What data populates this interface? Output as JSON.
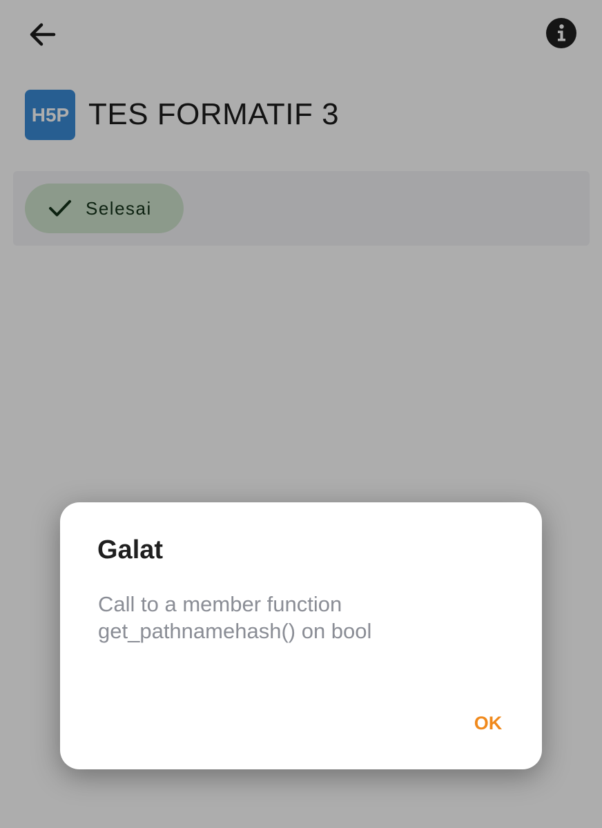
{
  "header": {
    "back_icon": "arrow-left-icon",
    "info_icon": "info-circle-icon",
    "title": "TES FORMATIF 3",
    "logo_text": "H5P",
    "logo_color": "#3a8bd6"
  },
  "completion": {
    "status_label": "Selesai",
    "status_icon": "checkmark-icon",
    "chip_color": "#cfe3cd"
  },
  "dialog": {
    "title": "Galat",
    "message": "Call to a member function get_pathnamehash() on bool",
    "ok_label": "OK",
    "accent_color": "#f0891c"
  }
}
